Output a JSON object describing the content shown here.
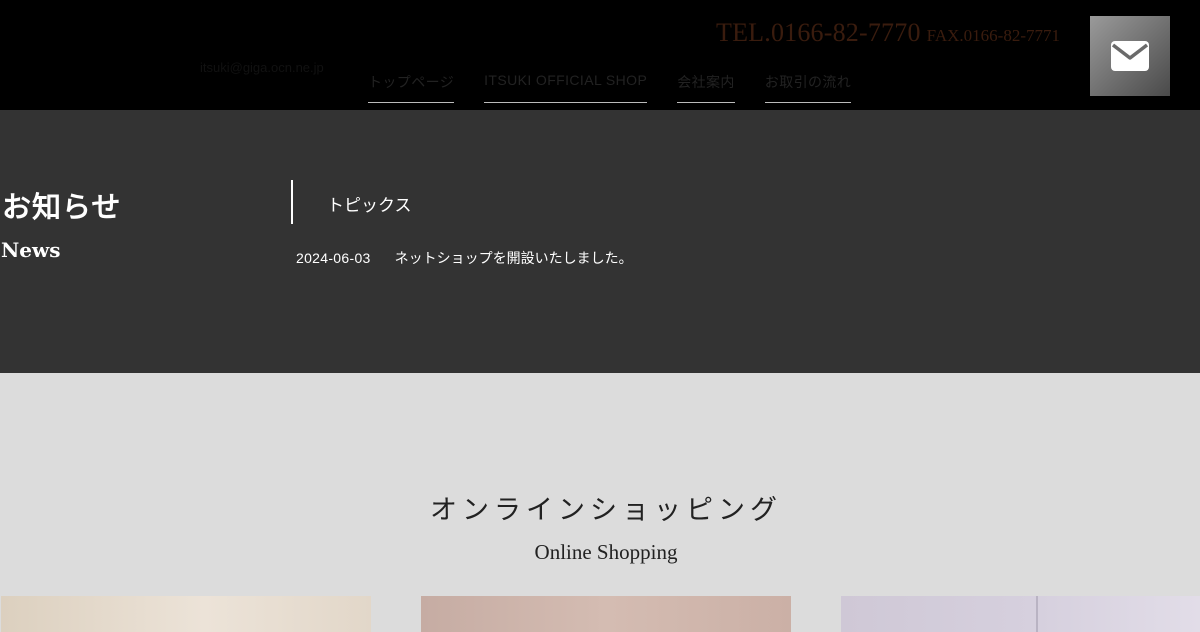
{
  "header": {
    "tel": "TEL.0166-82-7770",
    "fax": "FAX.0166-82-7771",
    "email": "itsuki@giga.ocn.ne.jp"
  },
  "nav": {
    "items": [
      {
        "label": "トップページ"
      },
      {
        "label": "ITSUKI OFFICIAL SHOP"
      },
      {
        "label": "会社案内"
      },
      {
        "label": "お取引の流れ"
      }
    ]
  },
  "news": {
    "title_jp": "お知らせ",
    "title_en": "News",
    "category": "トピックス",
    "items": [
      {
        "date": "2024-06-03",
        "text": "ネットショップを開設いたしました。"
      }
    ]
  },
  "shopping": {
    "title_jp": "オンラインショッピング",
    "title_en": "Online Shopping"
  },
  "icons": {
    "mail": "envelope-icon"
  }
}
